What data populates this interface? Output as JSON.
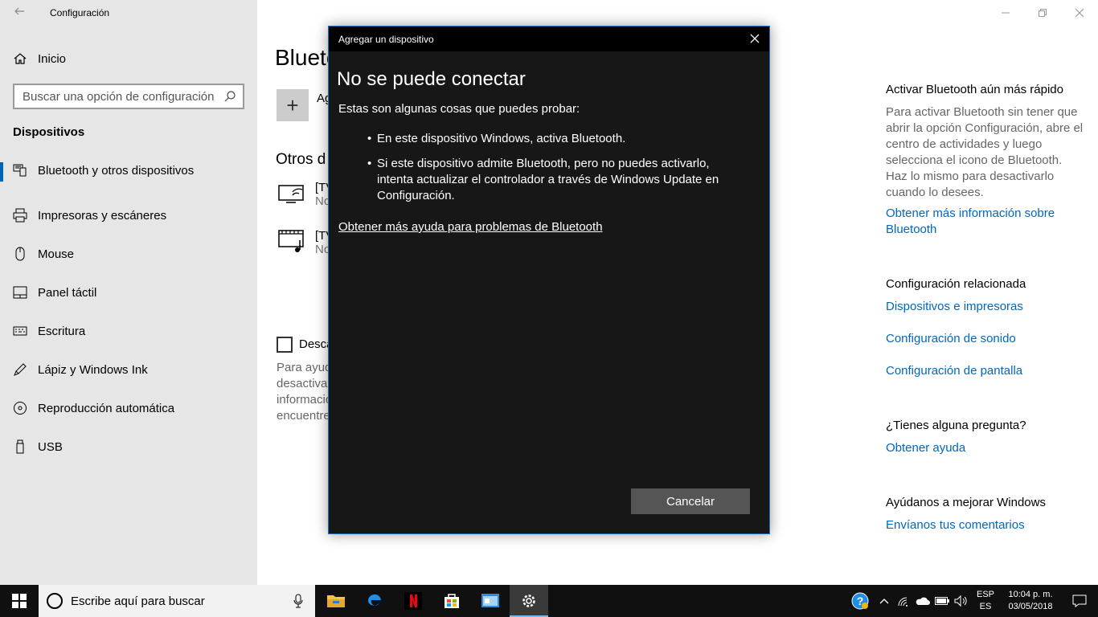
{
  "window": {
    "app_title": "Configuración",
    "back_icon": "back-arrow-icon"
  },
  "sidebar": {
    "home_label": "Inicio",
    "search_placeholder": "Buscar una opción de configuración",
    "section_heading": "Dispositivos",
    "items": [
      {
        "label": "Bluetooth y otros dispositivos",
        "icon": "bluetooth-devices-icon",
        "active": true
      },
      {
        "label": "Impresoras y escáneres",
        "icon": "printer-icon"
      },
      {
        "label": "Mouse",
        "icon": "mouse-icon"
      },
      {
        "label": "Panel táctil",
        "icon": "touchpad-icon"
      },
      {
        "label": "Escritura",
        "icon": "keyboard-icon"
      },
      {
        "label": "Lápiz y Windows Ink",
        "icon": "pen-icon"
      },
      {
        "label": "Reproducción automática",
        "icon": "autoplay-icon"
      },
      {
        "label": "USB",
        "icon": "usb-icon"
      }
    ]
  },
  "main": {
    "page_title": "Blueto",
    "add_label": "Ag",
    "other_heading": "Otros d",
    "devices": [
      {
        "name": "[TV",
        "status": "No"
      },
      {
        "name": "[TV",
        "status": "No"
      }
    ],
    "checkbox_label": "Desca",
    "desc_lines": [
      "Para ayud",
      "desactivad",
      "informacio",
      "encuentre"
    ]
  },
  "right": {
    "bt_heading": "Activar Bluetooth aún más rápido",
    "bt_text": "Para activar Bluetooth sin tener que abrir la opción Configuración, abre el centro de actividades y luego selecciona el icono de Bluetooth. Haz lo mismo para desactivarlo cuando lo desees.",
    "bt_link": "Obtener más información sobre Bluetooth",
    "related_heading": "Configuración relacionada",
    "related_links": [
      "Dispositivos e impresoras",
      "Configuración de sonido",
      "Configuración de pantalla"
    ],
    "question_heading": "¿Tienes alguna pregunta?",
    "help_link": "Obtener ayuda",
    "improve_heading": "Ayúdanos a mejorar Windows",
    "feedback_link": "Envíanos tus comentarios"
  },
  "dialog": {
    "title": "Agregar un dispositivo",
    "heading": "No se puede conectar",
    "intro": "Estas son algunas cosas que puedes probar:",
    "bullets": [
      "En este dispositivo Windows, activa Bluetooth.",
      "Si este dispositivo admite Bluetooth, pero no puedes activarlo, intenta actualizar el controlador a través de Windows Update en Configuración."
    ],
    "help_link": "Obtener más ayuda para problemas de Bluetooth",
    "cancel_label": "Cancelar"
  },
  "taskbar": {
    "search_text": "Escribe aquí para buscar",
    "apps": [
      {
        "name": "file-explorer-icon"
      },
      {
        "name": "edge-icon"
      },
      {
        "name": "netflix-icon"
      },
      {
        "name": "store-icon"
      },
      {
        "name": "control-panel-icon"
      },
      {
        "name": "settings-icon",
        "active": true
      }
    ],
    "lang_top": "ESP",
    "lang_bottom": "ES",
    "time": "10:04 p. m.",
    "date": "03/05/2018"
  },
  "colors": {
    "accent": "#0063b1",
    "link": "#0067c0",
    "dialog_bg": "#171717",
    "dialog_border": "#1e6fbf",
    "taskbar_bg": "#101010"
  }
}
